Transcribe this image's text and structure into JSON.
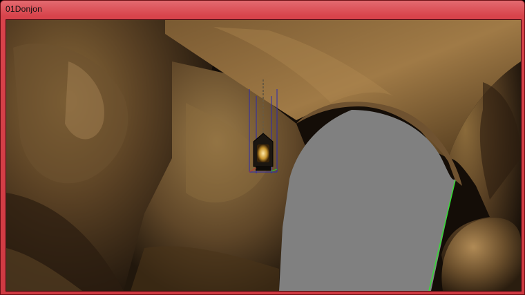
{
  "window": {
    "title": "01Donjon"
  }
}
